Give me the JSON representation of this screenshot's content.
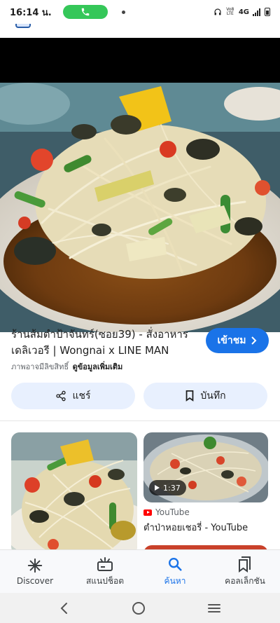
{
  "status_bar": {
    "time": "16:14 น.",
    "network": "4G",
    "volte": "Vo8 LTE"
  },
  "result": {
    "title": "ร้านส้มตำป้าจันทร์(ซอย39) - สั่งอาหารเดลิเวอรี | Wongnai x LINE MAN",
    "visit_label": "เข้าชม",
    "copyright_text": "ภาพอาจมีลิขสิทธิ์",
    "more_info_label": "ดูข้อมูลเพิ่มเติม"
  },
  "actions": {
    "share_label": "แชร์",
    "save_label": "บันทึก"
  },
  "related": {
    "video_duration": "1:37",
    "video_source": "YouTube",
    "video_title": "ตำป่าหอยเชอรี่ - YouTube"
  },
  "bottom_nav": {
    "items": [
      {
        "label": "Discover",
        "icon": "asterisk-icon"
      },
      {
        "label": "สแนปช็อต",
        "icon": "snapshot-icon"
      },
      {
        "label": "ค้นหา",
        "icon": "search-icon"
      },
      {
        "label": "คอลเล็กชัน",
        "icon": "collections-icon"
      }
    ]
  },
  "colors": {
    "accent": "#1a73e8",
    "chip_bg": "#e8f0fe",
    "call_green": "#35c759"
  }
}
